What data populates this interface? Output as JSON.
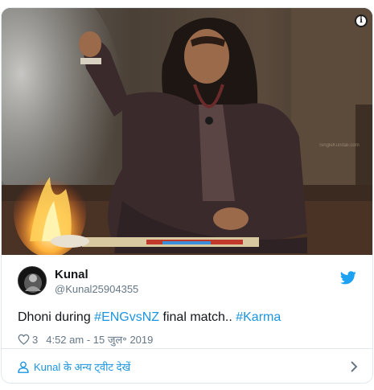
{
  "media": {
    "alt": "Photo",
    "info_glyph": "i"
  },
  "tweet": {
    "display_name": "Kunal",
    "handle": "@Kunal25904355",
    "text_prefix": "Dhoni during ",
    "hashtag_1": "#ENGvsNZ",
    "text_middle": " final match.. ",
    "hashtag_2": "#Karma",
    "like_count": "3",
    "timestamp": "4:52 am - 15 जुल॰ 2019"
  },
  "footer": {
    "more_tweets_label": "Kunal के अन्य ट्वीट देखें"
  },
  "colors": {
    "link": "#1b95e0",
    "secondary_text": "#657786",
    "border": "#e1e8ed",
    "twitter_blue": "#1da1f2"
  },
  "icons": [
    "info-icon",
    "twitter-bird-icon",
    "heart-icon",
    "user-icon",
    "chevron-right-icon"
  ]
}
